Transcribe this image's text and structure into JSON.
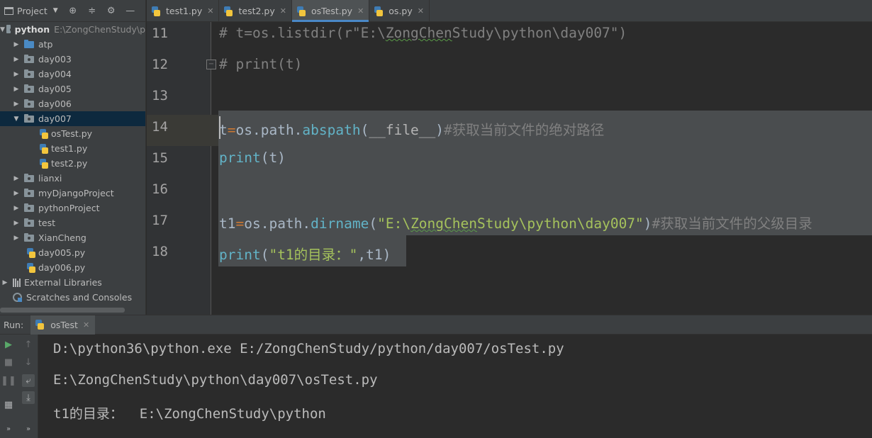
{
  "project_panel": {
    "title": "Project",
    "toolbar_icons": [
      "crosshair-icon",
      "collapse-icon",
      "gear-icon",
      "minimize-icon"
    ],
    "root": {
      "label": "python",
      "path": "E:\\ZongChenStudy\\p"
    },
    "items": [
      {
        "label": "atp",
        "kind": "folder-blue",
        "expanded": false
      },
      {
        "label": "day003",
        "kind": "package",
        "expanded": false
      },
      {
        "label": "day004",
        "kind": "package",
        "expanded": false
      },
      {
        "label": "day005",
        "kind": "package",
        "expanded": false
      },
      {
        "label": "day006",
        "kind": "package",
        "expanded": false
      },
      {
        "label": "day007",
        "kind": "package",
        "expanded": true
      },
      {
        "label": "osTest.py",
        "kind": "file"
      },
      {
        "label": "test1.py",
        "kind": "file"
      },
      {
        "label": "test2.py",
        "kind": "file"
      },
      {
        "label": "lianxi",
        "kind": "package",
        "expanded": false
      },
      {
        "label": "myDjangoProject",
        "kind": "package",
        "expanded": false
      },
      {
        "label": "pythonProject",
        "kind": "package",
        "expanded": false
      },
      {
        "label": "test",
        "kind": "package",
        "expanded": false
      },
      {
        "label": "XianCheng",
        "kind": "package",
        "expanded": false
      },
      {
        "label": "day005.py",
        "kind": "file"
      },
      {
        "label": "day006.py",
        "kind": "file"
      }
    ],
    "external_libraries": "External Libraries",
    "scratches": "Scratches and Consoles"
  },
  "tabs": [
    {
      "label": "test1.py",
      "active": false
    },
    {
      "label": "test2.py",
      "active": false
    },
    {
      "label": "osTest.py",
      "active": true
    },
    {
      "label": "os.py",
      "active": false
    }
  ],
  "editor": {
    "line_numbers": [
      "11",
      "12",
      "13",
      "14",
      "15",
      "16",
      "17",
      "18"
    ],
    "lines": {
      "l11": {
        "hash": "#",
        "text": " t=os.listdir(r\"E:\\",
        "squig": "ZongChen",
        "rest": "Study\\python\\day007\")"
      },
      "l12": {
        "text": "# print(t)"
      },
      "l14": {
        "t": "t",
        "eq": "=",
        "mod": "os.path.",
        "fn": "abspath",
        "open": "(",
        "arg": "__file__",
        "close": ")",
        "comment": "#获取当前文件的绝对路径"
      },
      "l15": {
        "fn": "print",
        "args": "(t)"
      },
      "l17": {
        "var": "t1",
        "eq": "=",
        "mod": "os.path.",
        "fn": "dirname",
        "open": "(",
        "str1": "\"E:\\",
        "squig": "ZongChen",
        "str2": "Study\\python\\day007\"",
        "close": ")",
        "comment": "#获取当前文件的父级目录"
      },
      "l18": {
        "fn": "print",
        "open": "(",
        "str": "\"t1的目录：\"",
        "rest": ",t1)"
      }
    }
  },
  "run_panel": {
    "label": "Run:",
    "tab_label": "osTest",
    "output": [
      "D:\\python36\\python.exe E:/ZongChenStudy/python/day007/osTest.py",
      "E:\\ZongChenStudy\\python\\day007\\osTest.py",
      "t1的目录：  E:\\ZongChenStudy\\python"
    ]
  },
  "colors": {
    "background": "#2b2b2b",
    "panel": "#3c3f41",
    "selection": "#4a4d4f",
    "keyword_builtin": "#62b3c7",
    "string": "#a5c25c",
    "comment": "#808080",
    "operator": "#cc7832"
  }
}
